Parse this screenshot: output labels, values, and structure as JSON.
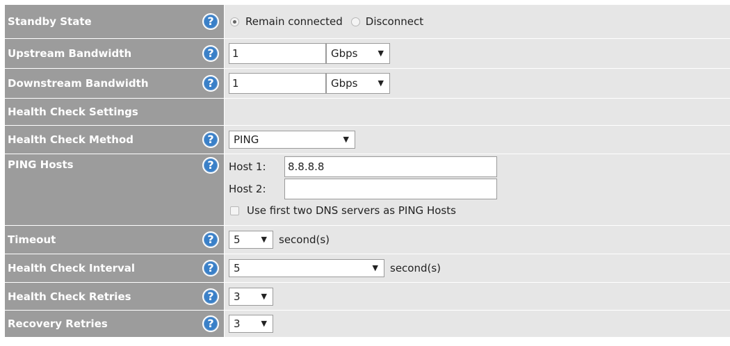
{
  "rows": {
    "standby_state": {
      "label": "Standby State",
      "options": [
        "Remain connected",
        "Disconnect"
      ],
      "selected": "Remain connected"
    },
    "upstream_bandwidth": {
      "label": "Upstream Bandwidth",
      "value": "1",
      "unit": "Gbps"
    },
    "downstream_bandwidth": {
      "label": "Downstream Bandwidth",
      "value": "1",
      "unit": "Gbps"
    },
    "health_check_settings": {
      "label": "Health Check Settings"
    },
    "health_check_method": {
      "label": "Health Check Method",
      "value": "PING"
    },
    "ping_hosts": {
      "label": "PING Hosts",
      "host1_label": "Host 1:",
      "host1_value": "8.8.8.8",
      "host2_label": "Host 2:",
      "host2_value": "",
      "dns_checkbox_label": "Use first two DNS servers as PING Hosts"
    },
    "timeout": {
      "label": "Timeout",
      "value": "5",
      "suffix": "second(s)"
    },
    "health_check_interval": {
      "label": "Health Check Interval",
      "value": "5",
      "suffix": "second(s)"
    },
    "health_check_retries": {
      "label": "Health Check Retries",
      "value": "3"
    },
    "recovery_retries": {
      "label": "Recovery Retries",
      "value": "3"
    }
  },
  "icons": {
    "help": "?",
    "dropdown_arrow": "▼"
  },
  "colors": {
    "label_bg": "#9c9c9c",
    "content_bg": "#e6e6e6",
    "help_icon": "#3a80c8"
  }
}
